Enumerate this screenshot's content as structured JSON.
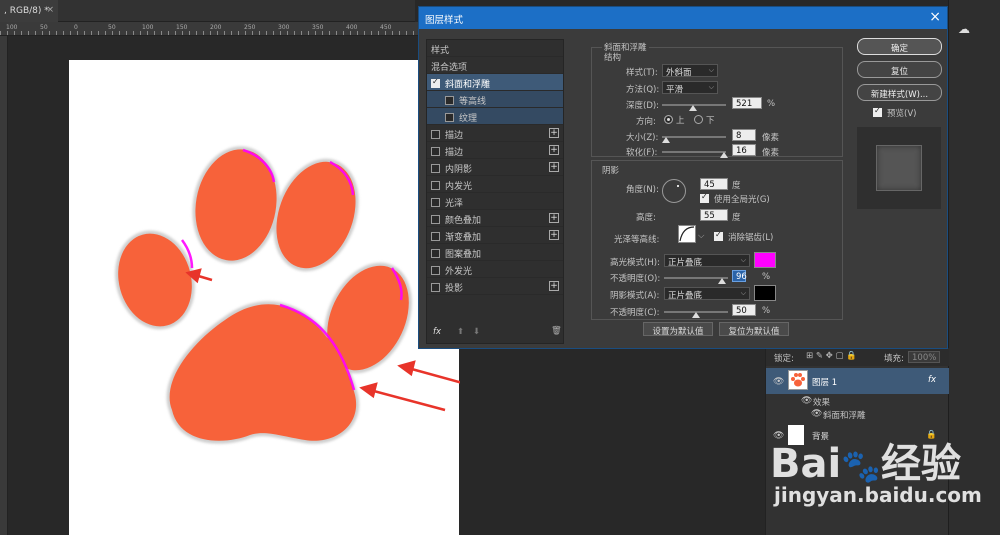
{
  "document": {
    "tab_title": ", RGB/8) *",
    "tab_close": "×"
  },
  "ruler": {
    "ticks": [
      "100",
      "50",
      "0",
      "50",
      "100",
      "150",
      "200",
      "250",
      "300",
      "350",
      "400",
      "450"
    ]
  },
  "dialog": {
    "title": "图层样式",
    "close": "×",
    "style_list": [
      {
        "label": "样式",
        "checkbox": false,
        "plus": false,
        "sub": false,
        "selected": false
      },
      {
        "label": "混合选项",
        "checkbox": false,
        "plus": false,
        "sub": false,
        "selected": false
      },
      {
        "label": "斜面和浮雕",
        "checkbox": true,
        "checked": true,
        "plus": false,
        "sub": false,
        "selected": true
      },
      {
        "label": "等高线",
        "checkbox": true,
        "checked": false,
        "plus": false,
        "sub": true,
        "selected": false
      },
      {
        "label": "纹理",
        "checkbox": true,
        "checked": false,
        "plus": false,
        "sub": true,
        "selected": false
      },
      {
        "label": "描边",
        "checkbox": true,
        "checked": false,
        "plus": true,
        "sub": false,
        "selected": false
      },
      {
        "label": "描边",
        "checkbox": true,
        "checked": false,
        "plus": true,
        "sub": false,
        "selected": false
      },
      {
        "label": "内阴影",
        "checkbox": true,
        "checked": false,
        "plus": true,
        "sub": false,
        "selected": false
      },
      {
        "label": "内发光",
        "checkbox": true,
        "checked": false,
        "plus": false,
        "sub": false,
        "selected": false
      },
      {
        "label": "光泽",
        "checkbox": true,
        "checked": false,
        "plus": false,
        "sub": false,
        "selected": false
      },
      {
        "label": "颜色叠加",
        "checkbox": true,
        "checked": false,
        "plus": true,
        "sub": false,
        "selected": false
      },
      {
        "label": "渐变叠加",
        "checkbox": true,
        "checked": false,
        "plus": true,
        "sub": false,
        "selected": false
      },
      {
        "label": "图案叠加",
        "checkbox": true,
        "checked": false,
        "plus": false,
        "sub": false,
        "selected": false
      },
      {
        "label": "外发光",
        "checkbox": true,
        "checked": false,
        "plus": false,
        "sub": false,
        "selected": false
      },
      {
        "label": "投影",
        "checkbox": true,
        "checked": false,
        "plus": true,
        "sub": false,
        "selected": false
      }
    ],
    "fx_label": "fx",
    "bevel": {
      "section_title": "斜面和浮雕",
      "structure_title": "结构",
      "style_label": "样式(T):",
      "style_value": "外斜面",
      "technique_label": "方法(Q):",
      "technique_value": "平滑",
      "depth_label": "深度(D):",
      "depth_value": "521",
      "depth_unit": "%",
      "direction_label": "方向:",
      "dir_up": "上",
      "dir_down": "下",
      "size_label": "大小(Z):",
      "size_value": "8",
      "size_unit": "像素",
      "soften_label": "软化(F):",
      "soften_value": "16",
      "soften_unit": "像素"
    },
    "shading": {
      "title": "阴影",
      "angle_label": "角度(N):",
      "angle_value": "45",
      "angle_unit": "度",
      "global_light": "使用全局光(G)",
      "altitude_label": "高度:",
      "altitude_value": "55",
      "altitude_unit": "度",
      "gloss_label": "光泽等高线:",
      "antialias": "消除锯齿(L)",
      "highlight_label": "高光模式(H):",
      "highlight_mode": "正片叠底",
      "highlight_color": "#ff00ff",
      "hl_opacity_label": "不透明度(O):",
      "hl_opacity_value": "96",
      "hl_opacity_unit": "%",
      "shadow_label": "阴影模式(A):",
      "shadow_mode": "正片叠底",
      "shadow_color": "#000000",
      "sh_opacity_label": "不透明度(C):",
      "sh_opacity_value": "50",
      "sh_opacity_unit": "%"
    },
    "set_default": "设置为默认值",
    "reset_default": "复位为默认值",
    "ok": "确定",
    "reset": "复位",
    "new_style": "新建样式(W)...",
    "preview": "预览(V)"
  },
  "layers": {
    "lock_label": "锁定:",
    "fill_label": "填充:",
    "fill_value": "100%",
    "layer1": "图层 1",
    "fx": "fx",
    "effects": "效果",
    "effect_item": "斜面和浮雕",
    "background": "背景"
  },
  "watermark": {
    "brand": "Bai",
    "brand2": "经验",
    "url": "jingyan.baidu.com"
  },
  "paw": {
    "fill": "#f7623a",
    "highlight": "#ff00ff",
    "arrow": "#e8342a"
  }
}
